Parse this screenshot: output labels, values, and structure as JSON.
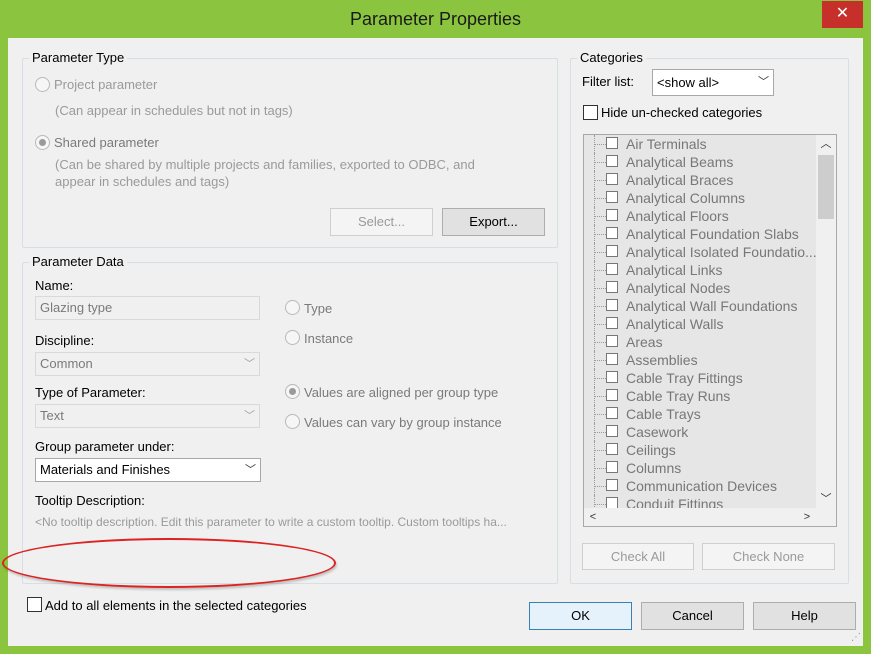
{
  "window": {
    "title": "Parameter Properties",
    "close_glyph": "✕"
  },
  "parameter_type": {
    "legend": "Parameter Type",
    "project_label": "Project parameter",
    "project_desc": "(Can appear in schedules but not in tags)",
    "shared_label": "Shared parameter",
    "shared_desc_line1": "(Can be shared by multiple projects and families, exported to ODBC, and",
    "shared_desc_line2": "appear in schedules and tags)",
    "select_button": "Select...",
    "export_button": "Export..."
  },
  "parameter_data": {
    "legend": "Parameter Data",
    "name_label": "Name:",
    "name_value": "Glazing type",
    "type_radio": "Type",
    "instance_radio": "Instance",
    "discipline_label": "Discipline:",
    "discipline_value": "Common",
    "type_of_param_label": "Type of Parameter:",
    "type_of_param_value": "Text",
    "aligned_radio": "Values are aligned per group type",
    "vary_radio": "Values can vary by group instance",
    "group_under_label": "Group parameter under:",
    "group_under_value": "Materials and Finishes",
    "tooltip_label": "Tooltip Description:",
    "tooltip_value": "<No tooltip description. Edit this parameter to write a custom tooltip. Custom tooltips ha..."
  },
  "categories": {
    "legend": "Categories",
    "filter_label": "Filter list:",
    "filter_value": "<show all>",
    "hide_unchecked_label": "Hide un-checked categories",
    "items": [
      "Air Terminals",
      "Analytical Beams",
      "Analytical Braces",
      "Analytical Columns",
      "Analytical Floors",
      "Analytical Foundation Slabs",
      "Analytical Isolated Foundatio...",
      "Analytical Links",
      "Analytical Nodes",
      "Analytical Wall Foundations",
      "Analytical Walls",
      "Areas",
      "Assemblies",
      "Cable Tray Fittings",
      "Cable Tray Runs",
      "Cable Trays",
      "Casework",
      "Ceilings",
      "Columns",
      "Communication Devices",
      "Conduit Fittings"
    ],
    "check_all_button": "Check All",
    "check_none_button": "Check None"
  },
  "footer": {
    "add_to_all_label": "Add to all elements in the selected categories",
    "ok_button": "OK",
    "cancel_button": "Cancel",
    "help_button": "Help"
  },
  "colors": {
    "titlebar": "#8bc53f",
    "close": "#c7302a",
    "highlight": "#dd2222"
  }
}
